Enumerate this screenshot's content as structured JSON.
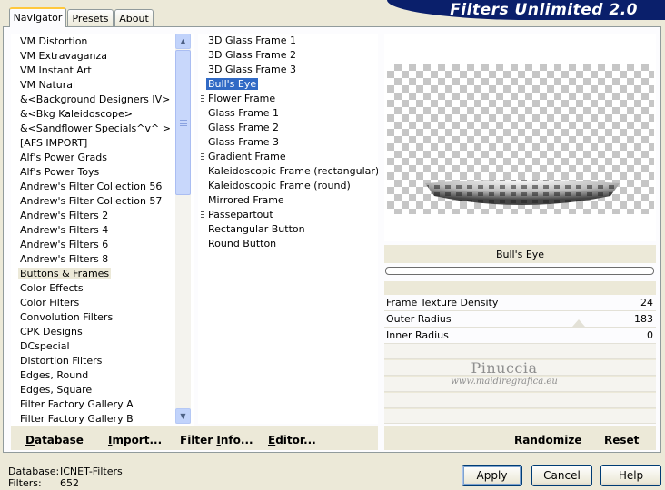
{
  "app": {
    "title": "Filters Unlimited 2.0"
  },
  "tabs": [
    {
      "label": "Navigator",
      "active": true
    },
    {
      "label": "Presets",
      "active": false
    },
    {
      "label": "About",
      "active": false
    }
  ],
  "categories": {
    "selected": "Buttons & Frames",
    "items": [
      "VM Distortion",
      "VM Extravaganza",
      "VM Instant Art",
      "VM Natural",
      "&<Background Designers IV>",
      "&<Bkg Kaleidoscope>",
      "&<Sandflower Specials^v^ >",
      "[AFS IMPORT]",
      "Alf's Power Grads",
      "Alf's Power Toys",
      "Andrew's Filter Collection 56",
      "Andrew's Filter Collection 57",
      "Andrew's Filters 2",
      "Andrew's Filters 4",
      "Andrew's Filters 6",
      "Andrew's Filters 8",
      "Buttons & Frames",
      "Color Effects",
      "Color Filters",
      "Convolution Filters",
      "CPK Designs",
      "DCspecial",
      "Distortion Filters",
      "Edges, Round",
      "Edges, Square",
      "Filter Factory Gallery A",
      "Filter Factory Gallery B"
    ]
  },
  "filters": {
    "selected": "Bull's Eye",
    "items": [
      {
        "label": "3D Glass Frame 1",
        "group": false
      },
      {
        "label": "3D Glass Frame 2",
        "group": false
      },
      {
        "label": "3D Glass Frame 3",
        "group": false
      },
      {
        "label": "Bull's Eye",
        "group": false
      },
      {
        "label": "Flower Frame",
        "group": true
      },
      {
        "label": "Glass Frame 1",
        "group": false
      },
      {
        "label": "Glass Frame 2",
        "group": false
      },
      {
        "label": "Glass Frame 3",
        "group": false
      },
      {
        "label": "Gradient Frame",
        "group": true
      },
      {
        "label": "Kaleidoscopic Frame (rectangular)",
        "group": false
      },
      {
        "label": "Kaleidoscopic Frame (round)",
        "group": false
      },
      {
        "label": "Mirrored Frame",
        "group": false
      },
      {
        "label": "Passepartout",
        "group": true
      },
      {
        "label": "Rectangular Button",
        "group": false
      },
      {
        "label": "Round Button",
        "group": false
      }
    ]
  },
  "preview": {
    "filter_name": "Bull's Eye"
  },
  "parameters": [
    {
      "name": "Frame Texture Density",
      "value": "24"
    },
    {
      "name": "Outer Radius",
      "value": "183"
    },
    {
      "name": "Inner Radius",
      "value": "0"
    }
  ],
  "watermark": {
    "name": "Pinuccia",
    "url": "www.maidiregrafica.eu"
  },
  "toolbar": {
    "database": {
      "u": "D",
      "rest": "atabase"
    },
    "import": {
      "u": "I",
      "rest": "mport..."
    },
    "filter_info": {
      "pre": "Filter ",
      "u": "I",
      "rest": "nfo..."
    },
    "editor": {
      "u": "E",
      "rest": "ditor..."
    },
    "randomize": "Randomize",
    "reset": "Reset"
  },
  "status": {
    "database_label": "Database:",
    "database_value": "ICNET-Filters",
    "filters_label": "Filters:",
    "filters_value": "652"
  },
  "buttons": {
    "apply": "Apply",
    "cancel": "Cancel",
    "help": "Help"
  }
}
